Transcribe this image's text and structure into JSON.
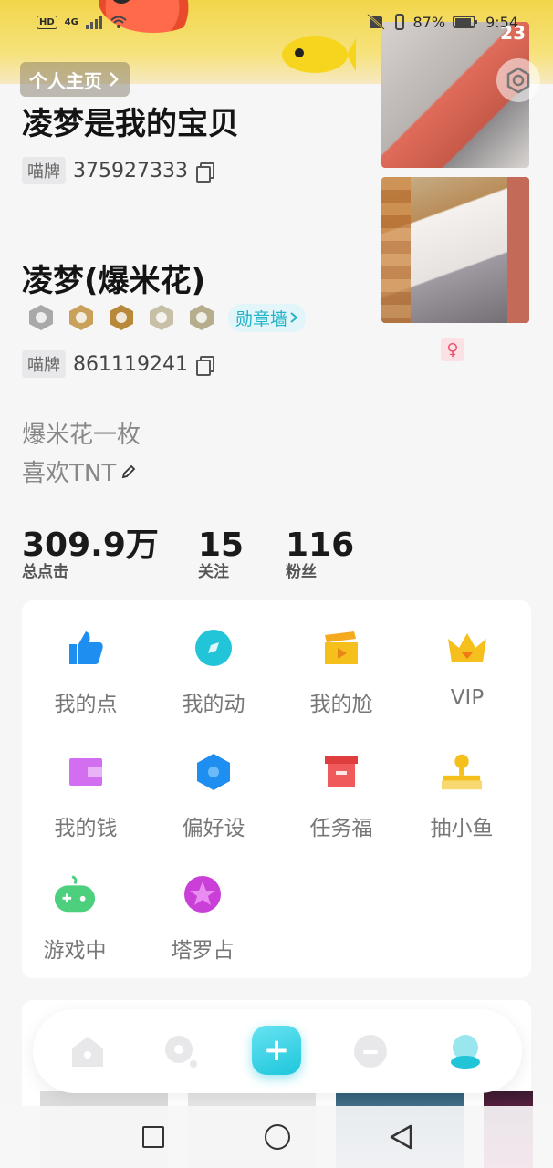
{
  "status_bar": {
    "left_badge": "HD",
    "network": "4G",
    "battery_pct": "87%",
    "time": "9:54"
  },
  "header": {
    "home_chip_label": "个人主页",
    "photo_tag": "23"
  },
  "profile_top": {
    "name": "凌梦是我的宝贝",
    "id_label": "喵牌",
    "id_number": "375927333"
  },
  "profile": {
    "name": "凌梦(爆米花)",
    "medal_wall_label": "勋章墙",
    "id_label": "喵牌",
    "id_number": "861119241",
    "gender_symbol": "♀",
    "bio_line1": "爆米花一枚",
    "bio_line2": "喜欢TNT"
  },
  "stats": [
    {
      "value": "309.9万",
      "label": "总点击"
    },
    {
      "value": "15",
      "label": "关注"
    },
    {
      "value": "116",
      "label": "粉丝"
    }
  ],
  "grid": [
    {
      "label": "我的点",
      "icon": "thumbs-up-icon",
      "color": "#1e8ff0"
    },
    {
      "label": "我的动",
      "icon": "compass-icon",
      "color": "#22c4d8"
    },
    {
      "label": "我的尬",
      "icon": "clapperboard-icon",
      "color": "#f5bf1c"
    },
    {
      "label": "VIP",
      "icon": "crown-icon",
      "color": "#f5bf1c"
    },
    {
      "label": "我的钱",
      "icon": "wallet-icon",
      "color": "#d26ef0"
    },
    {
      "label": "偏好设",
      "icon": "hexagon-settings-icon",
      "color": "#1e8ff0"
    },
    {
      "label": "任务福",
      "icon": "gift-box-icon",
      "color": "#f05a5a"
    },
    {
      "label": "抽小鱼",
      "icon": "fish-trophy-icon",
      "color": "#f5bf1c"
    },
    {
      "label": "游戏中",
      "icon": "gamepad-icon",
      "color": "#4cd07d"
    },
    {
      "label": "塔罗占",
      "icon": "tarot-ball-icon",
      "color": "#c93fd8"
    }
  ],
  "tabbar": {
    "plus_label": "+"
  },
  "colors": {
    "accent": "#1fc6dc",
    "banner": "#f2d64a",
    "female": "#e8546f"
  }
}
